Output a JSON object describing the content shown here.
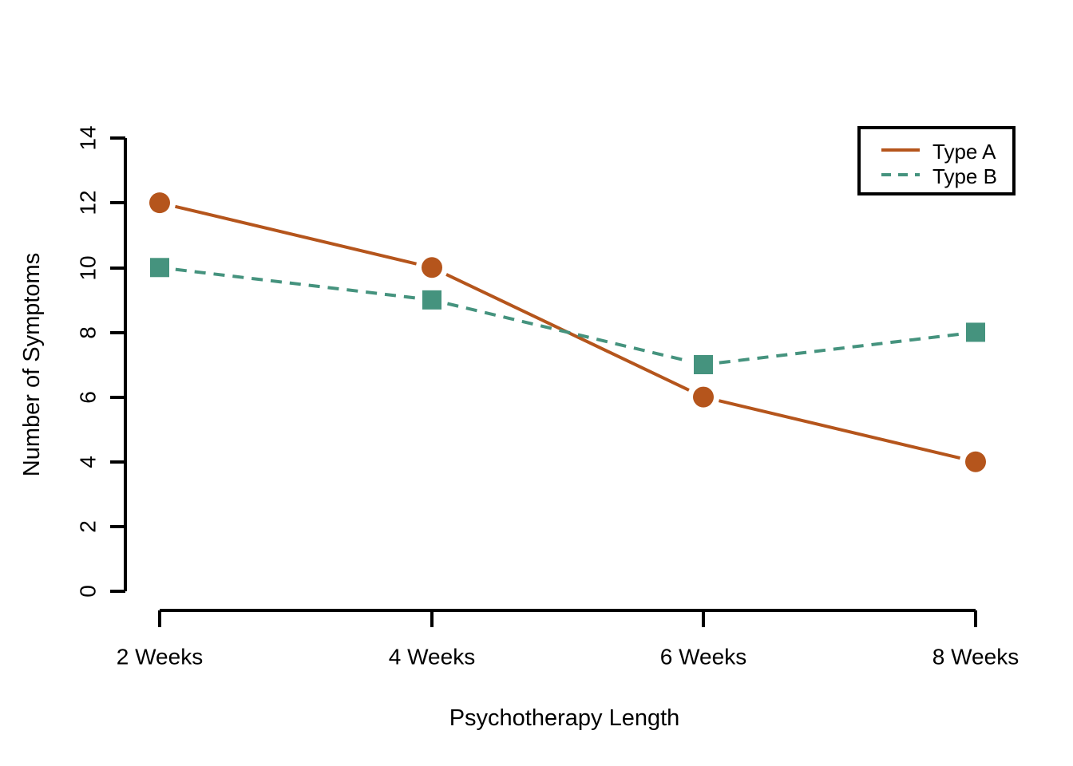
{
  "chart_data": {
    "type": "line",
    "title": "",
    "xlabel": "Psychotherapy Length",
    "ylabel": "Number of Symptoms",
    "categories": [
      "2 Weeks",
      "4 Weeks",
      "6 Weeks",
      "8 Weeks"
    ],
    "ylim": [
      0,
      14
    ],
    "yticks": [
      "0",
      "2",
      "4",
      "6",
      "8",
      "10",
      "12",
      "14"
    ],
    "ytick_values": [
      0,
      2,
      4,
      6,
      8,
      10,
      12,
      14
    ],
    "grid": false,
    "legend_position": "top-right",
    "series": [
      {
        "name": "Type A",
        "values": [
          12,
          10,
          6,
          4
        ],
        "color": "#b5551c",
        "line_style": "solid",
        "marker": "circle"
      },
      {
        "name": "Type B",
        "values": [
          10,
          9,
          7,
          8
        ],
        "color": "#45937e",
        "line_style": "dashed",
        "marker": "square"
      }
    ]
  },
  "legend": {
    "items": [
      {
        "label": "Type A"
      },
      {
        "label": "Type B"
      }
    ]
  },
  "axes": {
    "y_label": "Number of Symptoms",
    "x_label": "Psychotherapy Length",
    "y_tick_labels": [
      "0",
      "2",
      "4",
      "6",
      "8",
      "10",
      "12",
      "14"
    ],
    "x_tick_labels": [
      "2 Weeks",
      "4 Weeks",
      "6 Weeks",
      "8 Weeks"
    ]
  }
}
